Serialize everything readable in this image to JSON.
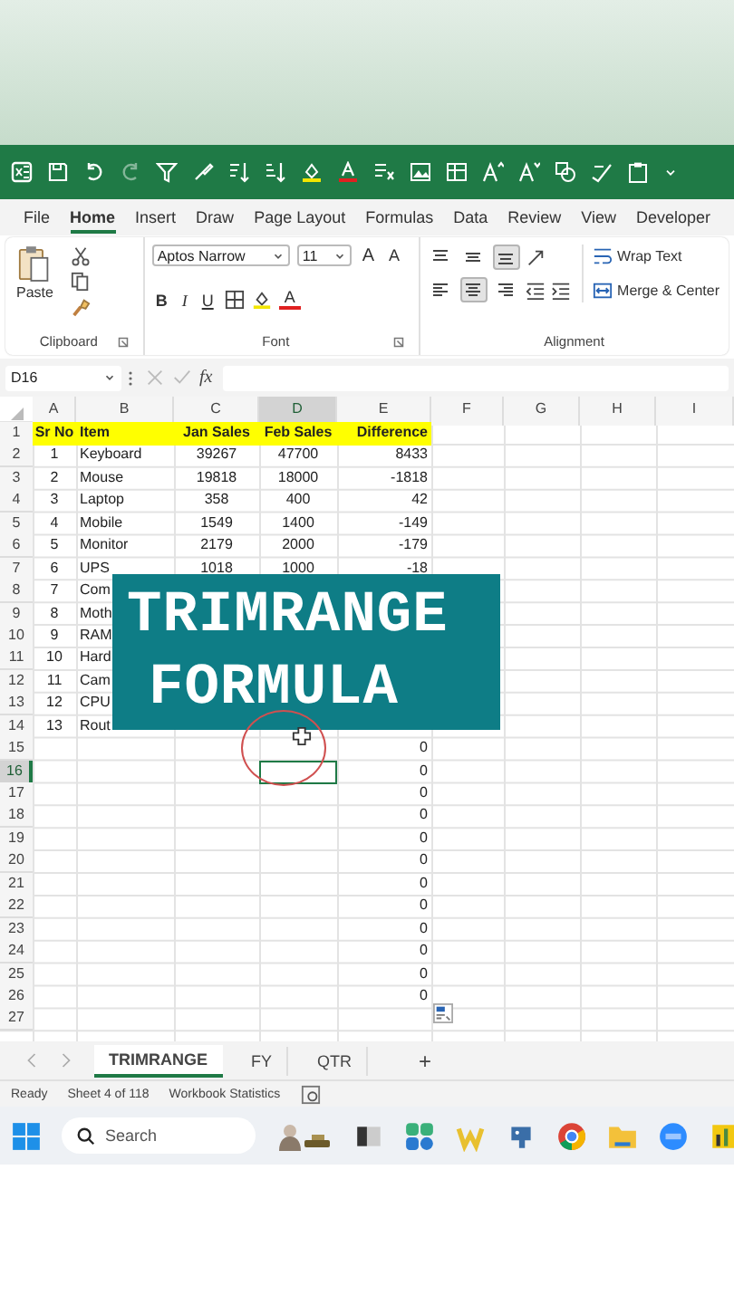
{
  "menu_tabs": [
    {
      "label": "File",
      "selected": false
    },
    {
      "label": "Home",
      "selected": true
    },
    {
      "label": "Insert",
      "selected": false
    },
    {
      "label": "Draw",
      "selected": false
    },
    {
      "label": "Page Layout",
      "selected": false
    },
    {
      "label": "Formulas",
      "selected": false
    },
    {
      "label": "Data",
      "selected": false
    },
    {
      "label": "Review",
      "selected": false
    },
    {
      "label": "View",
      "selected": false
    },
    {
      "label": "Developer",
      "selected": false
    }
  ],
  "ribbon": {
    "clipboard": {
      "paste": "Paste",
      "label": "Clipboard"
    },
    "font": {
      "face": "Aptos Narrow",
      "size": "11",
      "grow": "A",
      "shrink": "A",
      "bold": "B",
      "italic": "I",
      "underline": "U",
      "color_letter": "A",
      "label": "Font"
    },
    "alignment": {
      "vertical_align": [
        {
          "selected": false
        },
        {
          "selected": false
        },
        {
          "selected": true
        }
      ],
      "horizontal_align": [
        {
          "selected": false
        },
        {
          "selected": true
        },
        {
          "selected": false
        }
      ],
      "wrap": "Wrap Text",
      "merge": "Merge & Center",
      "label": "Alignment"
    }
  },
  "formula_bar": {
    "name_box": "D16",
    "fx": "fx"
  },
  "columns": [
    {
      "label": "A",
      "selected": false
    },
    {
      "label": "B",
      "selected": false
    },
    {
      "label": "C",
      "selected": false
    },
    {
      "label": "D",
      "selected": true
    },
    {
      "label": "E",
      "selected": false
    },
    {
      "label": "F",
      "selected": false
    },
    {
      "label": "G",
      "selected": false
    },
    {
      "label": "H",
      "selected": false
    },
    {
      "label": "I",
      "selected": false
    }
  ],
  "rows": [
    {
      "num": "1",
      "kind": "header",
      "selected": false,
      "a": "Sr No",
      "b": "Item",
      "c": "Jan Sales",
      "d": "Feb Sales",
      "e": "Difference"
    },
    {
      "num": "2",
      "kind": "data",
      "selected": false,
      "a": "1",
      "b": "Keyboard",
      "c": "39267",
      "d": "47700",
      "e": "8433"
    },
    {
      "num": "3",
      "kind": "data",
      "selected": false,
      "a": "2",
      "b": "Mouse",
      "c": "19818",
      "d": "18000",
      "e": "-1818"
    },
    {
      "num": "4",
      "kind": "data",
      "selected": false,
      "a": "3",
      "b": "Laptop",
      "c": "358",
      "d": "400",
      "e": "42"
    },
    {
      "num": "5",
      "kind": "data",
      "selected": false,
      "a": "4",
      "b": "Mobile",
      "c": "1549",
      "d": "1400",
      "e": "-149"
    },
    {
      "num": "6",
      "kind": "data",
      "selected": false,
      "a": "5",
      "b": "Monitor",
      "c": "2179",
      "d": "2000",
      "e": "-179"
    },
    {
      "num": "7",
      "kind": "data",
      "selected": false,
      "a": "6",
      "b": "UPS",
      "c": "1018",
      "d": "1000",
      "e": "-18"
    },
    {
      "num": "8",
      "kind": "data",
      "selected": false,
      "a": "7",
      "b": "Com"
    },
    {
      "num": "9",
      "kind": "data",
      "selected": false,
      "a": "8",
      "b": "Moth"
    },
    {
      "num": "10",
      "kind": "data",
      "selected": false,
      "a": "9",
      "b": "RAM"
    },
    {
      "num": "11",
      "kind": "data",
      "selected": false,
      "a": "10",
      "b": "Hard"
    },
    {
      "num": "12",
      "kind": "data",
      "selected": false,
      "a": "11",
      "b": "Cam"
    },
    {
      "num": "13",
      "kind": "data",
      "selected": false,
      "a": "12",
      "b": "CPU"
    },
    {
      "num": "14",
      "kind": "data",
      "selected": false,
      "a": "13",
      "b": "Rout"
    },
    {
      "num": "15",
      "kind": "data",
      "selected": false,
      "e": "0"
    },
    {
      "num": "16",
      "kind": "data",
      "selected": true,
      "e": "0"
    },
    {
      "num": "17",
      "kind": "data",
      "selected": false,
      "e": "0"
    },
    {
      "num": "18",
      "kind": "data",
      "selected": false,
      "e": "0"
    },
    {
      "num": "19",
      "kind": "data",
      "selected": false,
      "e": "0"
    },
    {
      "num": "20",
      "kind": "data",
      "selected": false,
      "e": "0"
    },
    {
      "num": "21",
      "kind": "data",
      "selected": false,
      "e": "0"
    },
    {
      "num": "22",
      "kind": "data",
      "selected": false,
      "e": "0"
    },
    {
      "num": "23",
      "kind": "data",
      "selected": false,
      "e": "0"
    },
    {
      "num": "24",
      "kind": "data",
      "selected": false,
      "e": "0"
    },
    {
      "num": "25",
      "kind": "data",
      "selected": false,
      "e": "0"
    },
    {
      "num": "26",
      "kind": "data",
      "selected": false,
      "e": "0"
    },
    {
      "num": "27",
      "kind": "data",
      "selected": false
    }
  ],
  "overlay": {
    "lines": [
      "TRIMRANGE",
      "FORMULA"
    ]
  },
  "sheet_tabs": [
    {
      "label": "TRIMRANGE",
      "selected": true
    },
    {
      "label": "FY",
      "selected": false
    },
    {
      "label": "QTR",
      "selected": false
    }
  ],
  "add_sheet": "+",
  "status_bar": {
    "items": [
      "Ready",
      "Sheet 4 of 118",
      "Workbook Statistics"
    ]
  },
  "taskbar": {
    "search": {
      "placeholder": "Search"
    }
  }
}
